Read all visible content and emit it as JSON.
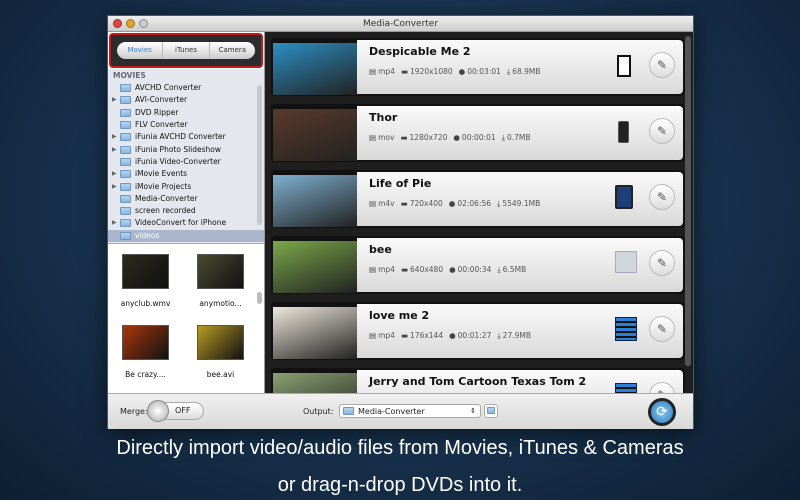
{
  "window": {
    "title": "Media-Converter"
  },
  "source_tabs": [
    {
      "label": "Movies",
      "active": true
    },
    {
      "label": "iTunes",
      "active": false
    },
    {
      "label": "Camera",
      "active": false
    }
  ],
  "tree": {
    "header": "MOVIES",
    "items": [
      {
        "label": "AVCHD Converter",
        "expandable": false
      },
      {
        "label": "AVI-Converter",
        "expandable": true
      },
      {
        "label": "DVD Ripper",
        "expandable": false
      },
      {
        "label": "FLV Converter",
        "expandable": false
      },
      {
        "label": "iFunia AVCHD Converter",
        "expandable": true
      },
      {
        "label": "iFunia Photo Slideshow",
        "expandable": true
      },
      {
        "label": "iFunia Video-Converter",
        "expandable": false
      },
      {
        "label": "iMovie Events",
        "expandable": true
      },
      {
        "label": "iMovie Projects",
        "expandable": true
      },
      {
        "label": "Media-Converter",
        "expandable": false
      },
      {
        "label": "screen recorded",
        "expandable": false
      },
      {
        "label": "VideoConvert for iPhone",
        "expandable": true
      },
      {
        "label": "videos",
        "expandable": false,
        "selected": true
      }
    ]
  },
  "thumbnails": [
    {
      "label": "anyclub.wmv",
      "color": "#2a2a1c"
    },
    {
      "label": "anymotio...",
      "color": "#4a4a32"
    },
    {
      "label": "Be crazy....",
      "color": "#a8380c"
    },
    {
      "label": "bee.avi",
      "color": "#b89a22"
    }
  ],
  "videos": [
    {
      "title": "Despicable Me 2",
      "format": "mp4",
      "resolution": "1920x1080",
      "duration": "00:03:01",
      "size": "68.9MB",
      "device": "kindle",
      "thumb": "#2c8fc4"
    },
    {
      "title": "Thor",
      "format": "mov",
      "resolution": "1280x720",
      "duration": "00:00:01",
      "size": "0.7MB",
      "device": "iphone",
      "thumb": "#5a3a2a"
    },
    {
      "title": "Life of Pie",
      "format": "m4v",
      "resolution": "720x400",
      "duration": "02:06:56",
      "size": "5549.1MB",
      "device": "ipad",
      "thumb": "#7fb0d0"
    },
    {
      "title": "bee",
      "format": "mp4",
      "resolution": "640x480",
      "duration": "00:00:34",
      "size": "6.5MB",
      "device": "apple-tv",
      "thumb": "#7aa84a"
    },
    {
      "title": "love me 2",
      "format": "mp4",
      "resolution": "176x144",
      "duration": "00:01:27",
      "size": "27.9MB",
      "device": "video-file",
      "thumb": "#eee8dc"
    },
    {
      "title": "Jerry and Tom Cartoon Texas Tom 2",
      "format": "",
      "resolution": "",
      "duration": "",
      "size": "",
      "device": "video-file",
      "thumb": "#8aa070"
    }
  ],
  "bottom": {
    "merge_label": "Merge:",
    "merge_state": "OFF",
    "output_label": "Output:",
    "output_value": "Media-Converter"
  },
  "caption": {
    "line1": "Directly import video/audio files from Movies, iTunes & Cameras",
    "line2": "or drag-n-drop DVDs into it."
  }
}
